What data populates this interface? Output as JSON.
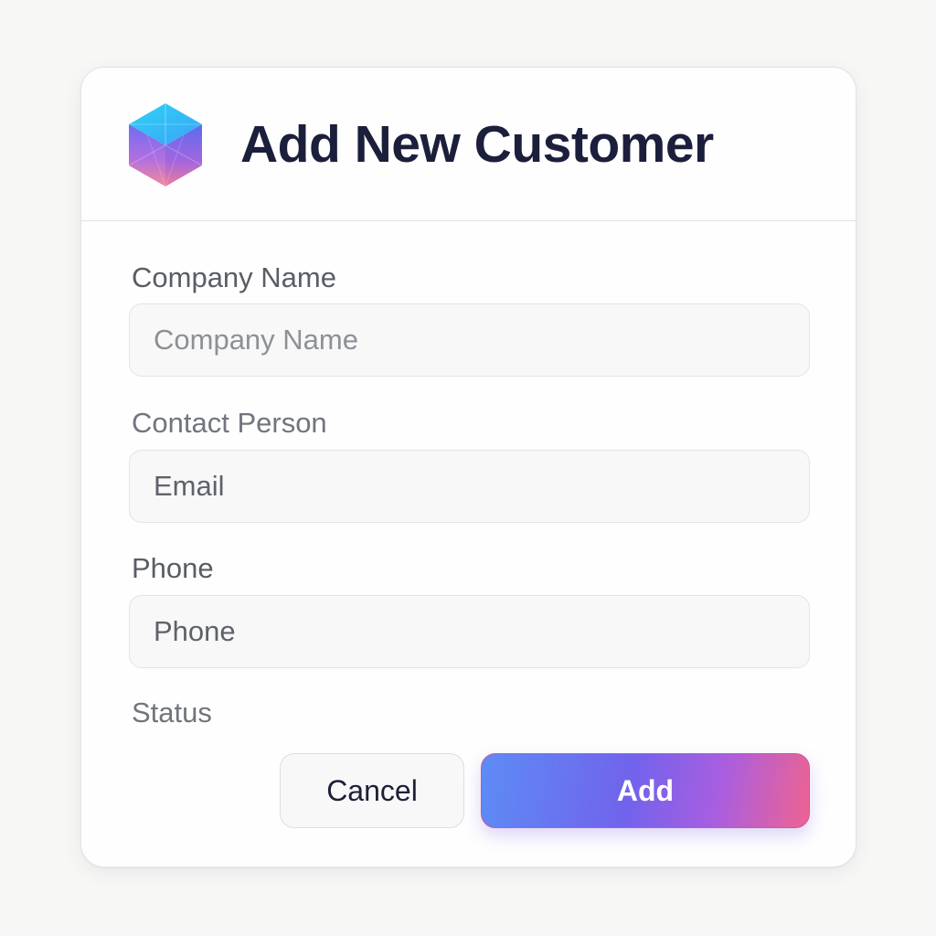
{
  "dialog": {
    "title": "Add New Customer",
    "logo_icon": "hexagon-cube-icon"
  },
  "form": {
    "company_name": {
      "label": "Company Name",
      "placeholder": "Company Name",
      "value": ""
    },
    "contact_person": {
      "label": "Contact Person",
      "placeholder": "Email",
      "value": ""
    },
    "phone": {
      "label": "Phone",
      "placeholder": "Phone",
      "value": ""
    },
    "status": {
      "label": "Status"
    }
  },
  "actions": {
    "cancel_label": "Cancel",
    "add_label": "Add"
  },
  "colors": {
    "title_text": "#1b1f3b",
    "add_gradient_start": "#5d8cf5",
    "add_gradient_mid": "#7163ec",
    "add_gradient_end": "#ee6391"
  }
}
